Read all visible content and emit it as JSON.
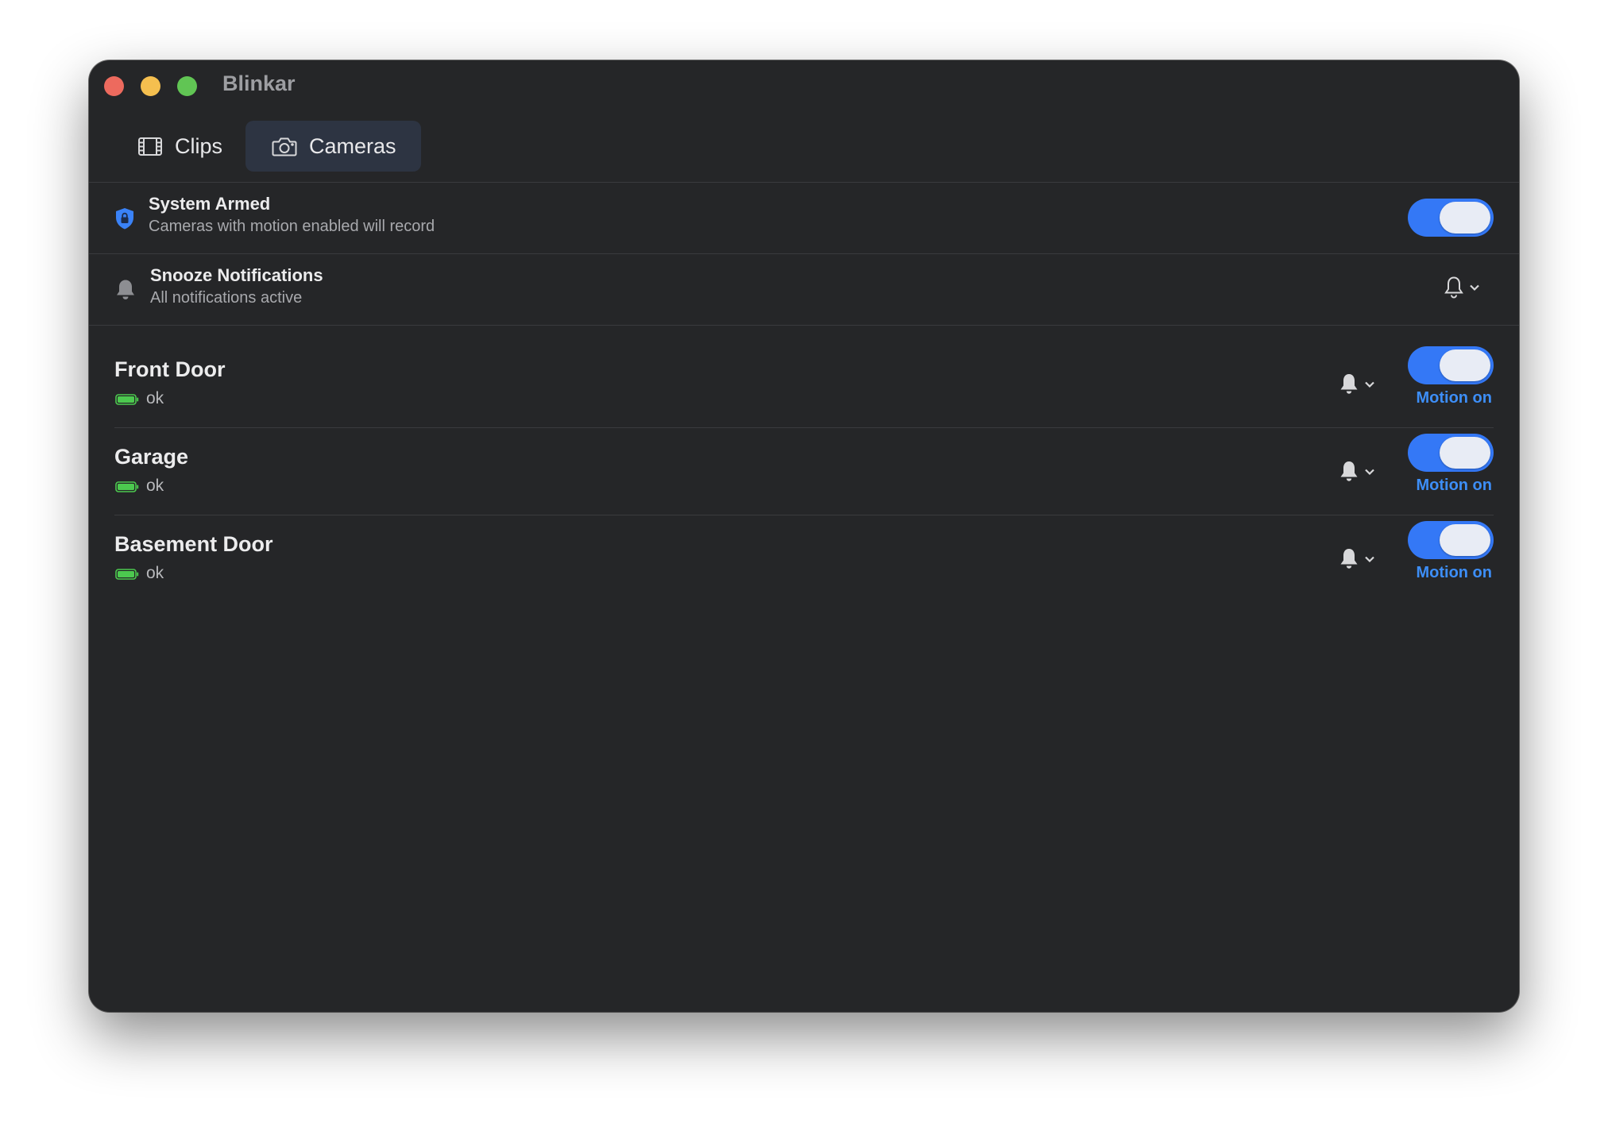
{
  "window": {
    "title": "Blinkar"
  },
  "tabs": [
    {
      "label": "Clips",
      "icon": "film-icon",
      "selected": false
    },
    {
      "label": "Cameras",
      "icon": "camera-icon",
      "selected": true
    }
  ],
  "system_armed": {
    "title": "System Armed",
    "subtitle": "Cameras with motion enabled will record",
    "icon": "shield-lock-icon",
    "enabled": true
  },
  "snooze": {
    "title": "Snooze Notifications",
    "subtitle": "All notifications active",
    "icon": "bell-icon"
  },
  "cameras": [
    {
      "name": "Front Door",
      "battery_status": "ok",
      "motion_label": "Motion on",
      "motion_enabled": true
    },
    {
      "name": "Garage",
      "battery_status": "ok",
      "motion_label": "Motion on",
      "motion_enabled": true
    },
    {
      "name": "Basement Door",
      "battery_status": "ok",
      "motion_label": "Motion on",
      "motion_enabled": true
    }
  ],
  "colors": {
    "accent": "#3478f6",
    "motion_text": "#3d8ef7",
    "battery": "#4cc94f",
    "shield": "#3a82f7",
    "window_bg": "#252628"
  }
}
